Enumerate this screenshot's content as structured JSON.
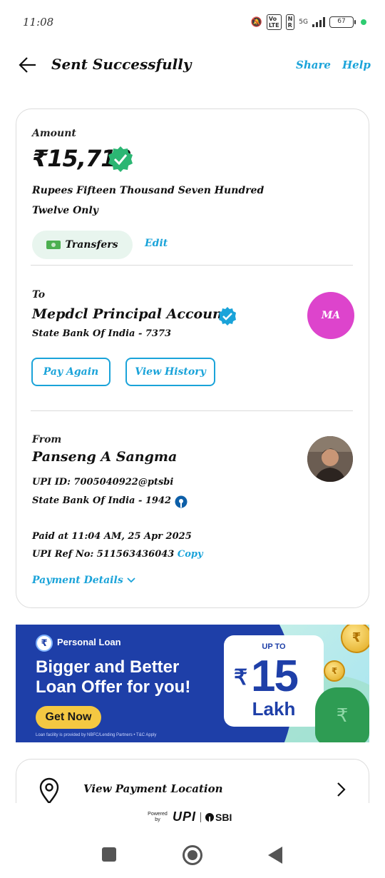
{
  "status_bar": {
    "time": "11:08",
    "network": "5G",
    "volte": "Vo LTE",
    "battery": "67",
    "accent_dot": "#2ecc71"
  },
  "header": {
    "title": "Sent Successfully",
    "share_label": "Share",
    "help_label": "Help",
    "back_icon": "arrow-left-icon"
  },
  "transaction": {
    "amount_label": "Amount",
    "amount": "₹15,712",
    "amount_words": "Rupees Fifteen Thousand Seven Hundred Twelve Only",
    "category_label": "Transfers",
    "edit_label": "Edit",
    "to_label": "To",
    "recipient_name": "Mepdcl Principal Account",
    "recipient_bank": "State Bank Of India - 7373",
    "recipient_initials": "MA",
    "pay_again_label": "Pay Again",
    "view_history_label": "View History",
    "from_label": "From",
    "sender_name": "Panseng A Sangma",
    "upi_id": "UPI ID: 7005040922@ptsbi",
    "sender_bank": "State Bank Of India - 1942",
    "paid_at": "Paid at 11:04 AM, 25 Apr 2025",
    "upi_ref": "UPI Ref No: 511563436043",
    "copy_label": "Copy",
    "payment_details_label": "Payment Details"
  },
  "banner": {
    "tag": "Personal Loan",
    "headline": "Bigger and Better Loan Offer for you!",
    "cta": "Get Now",
    "fine_print": "Loan facility is provided by NBFC/Lending Partners • T&C Apply",
    "upto": "UP TO",
    "offer_rupee": "₹",
    "offer_amount": "15",
    "offer_unit": "Lakh",
    "brand_color": "#1e3fa8"
  },
  "location": {
    "label": "View Payment Location"
  },
  "footer": {
    "powered_by": "Powered by",
    "upi": "UPI",
    "bank": "SBI"
  },
  "colors": {
    "link": "#1aa3d9",
    "verified_green": "#2bb673",
    "verified_blue": "#1aa3d9",
    "avatar_bg": "#dd44cc"
  }
}
